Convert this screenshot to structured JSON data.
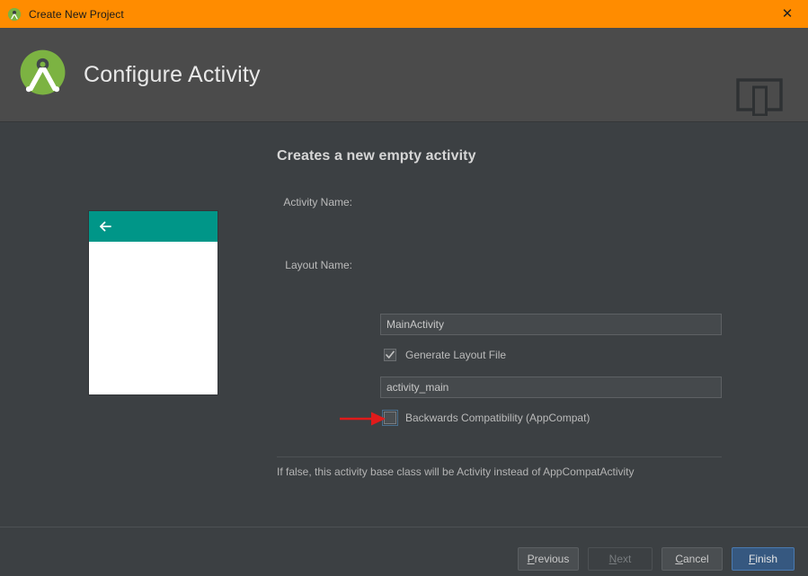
{
  "titlebar": {
    "title": "Create New Project",
    "app_icon": "android-studio-icon",
    "close_label": "✕",
    "bg_color": "#ff8c00"
  },
  "header": {
    "title": "Configure Activity",
    "logo": "android-studio-logo",
    "device_icon": "device-preview-icon",
    "bg_color": "#4b4b4b"
  },
  "preview": {
    "appbar_color": "#009688",
    "back_icon": "back-arrow-icon",
    "body_color": "#ffffff"
  },
  "form": {
    "title": "Creates a new empty activity",
    "fields": [
      {
        "label": "Activity Name:",
        "value": "MainActivity",
        "placeholder": "Activity Name"
      },
      {
        "label": "Layout Name:",
        "value": "activity_main",
        "placeholder": "Layout Name"
      }
    ],
    "checkboxes": [
      {
        "label": "Generate Layout File",
        "checked": true,
        "focused": false
      },
      {
        "label": "Backwards Compatibility (AppCompat)",
        "checked": false,
        "focused": true
      }
    ],
    "help_text": "If false, this activity base class will be Activity instead of AppCompatActivity",
    "annotation": {
      "type": "red-arrow",
      "color": "#e01b1b",
      "points_to": "Backwards Compatibility (AppCompat)"
    }
  },
  "footer": {
    "buttons": [
      {
        "label": "Previous",
        "mnemonic": "P",
        "state": "enabled",
        "primary": false
      },
      {
        "label": "Next",
        "mnemonic": "N",
        "state": "disabled",
        "primary": false
      },
      {
        "label": "Cancel",
        "mnemonic": "C",
        "state": "enabled",
        "primary": false
      },
      {
        "label": "Finish",
        "mnemonic": "F",
        "state": "enabled",
        "primary": true
      }
    ],
    "accent_color": "#365880"
  }
}
